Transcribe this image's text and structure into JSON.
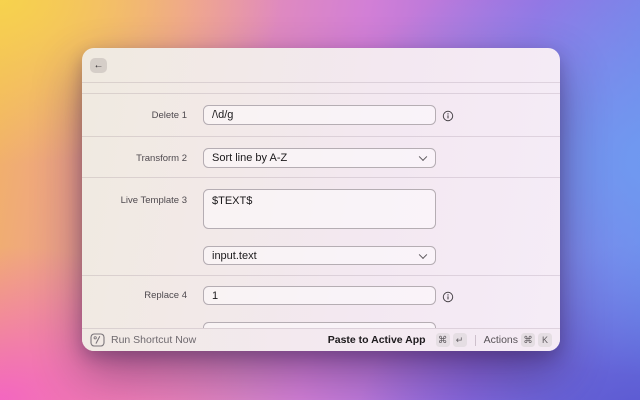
{
  "window": {
    "header": {
      "back_icon": "←"
    },
    "form": {
      "rows": [
        {
          "label": "Delete 1",
          "control": "input",
          "value": "/\\d/g",
          "has_info": true
        },
        {
          "label": "Transform 2",
          "control": "select",
          "value": "Sort line by A-Z",
          "has_info": false
        },
        {
          "label": "Live Template 3",
          "control": "textarea",
          "value": "$TEXT$",
          "has_info": false
        },
        {
          "label": "",
          "control": "select",
          "value": "input.text",
          "has_info": false
        },
        {
          "label": "Replace 4",
          "control": "input",
          "value": "1",
          "has_info": true
        }
      ]
    },
    "footer": {
      "run_label": "Run Shortcut Now",
      "primary_label": "Paste to Active App",
      "primary_keys": [
        "⌘",
        "↵"
      ],
      "actions_label": "Actions",
      "actions_keys": [
        "⌘",
        "K"
      ]
    }
  },
  "icons": {
    "back": "arrow-left-icon",
    "info": "info-circle-icon",
    "select": "chevron-down-icon",
    "run": "shortcut-slash-icon"
  },
  "colors": {
    "bg_yellow": "#f7d44c",
    "bg_salmon": "#eb93ab",
    "bg_magenta": "#d27fd6",
    "bg_purple": "#9a70e2",
    "bg_blue": "#6e9cf1",
    "bg_indigo": "#5b54cf",
    "bg_pink": "#f45fc8",
    "window_tint_left": "#f0eae0",
    "window_tint_right": "#f5ecf7",
    "control_border": "#b5adb3",
    "key_badge_bg": "#e5dee3",
    "text_dark": "#1b191b",
    "text_gray": "#6e696e"
  }
}
